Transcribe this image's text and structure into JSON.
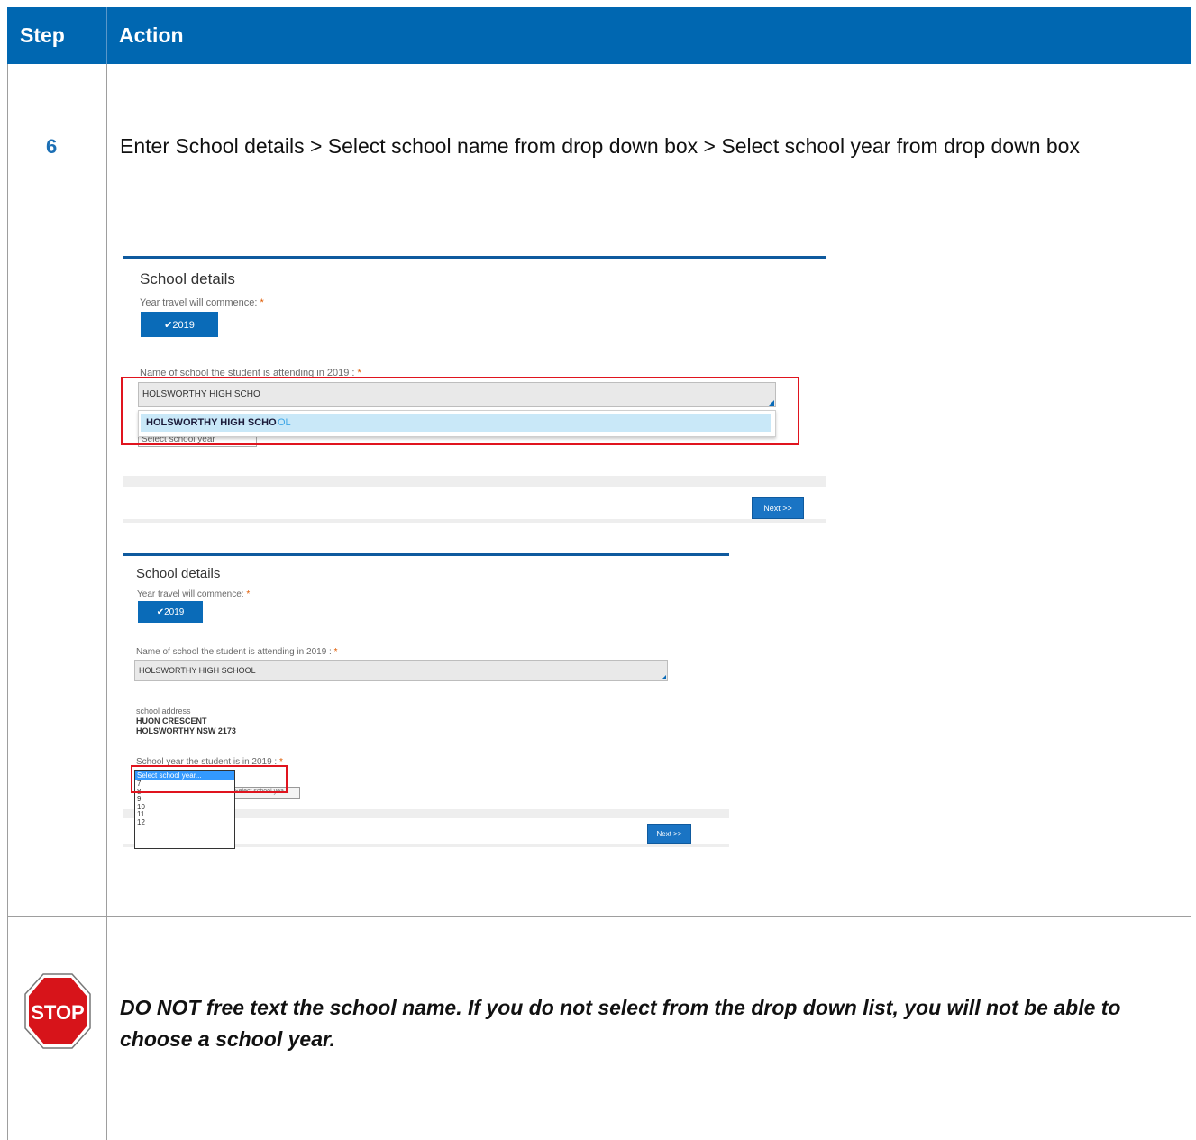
{
  "header": {
    "step": "Step",
    "action": "Action"
  },
  "step": {
    "number": "6",
    "instruction": "Enter School details > Select school name from drop down box > Select school year from drop down box"
  },
  "shot1": {
    "title": "School details",
    "year_label": "Year travel will commence:",
    "year_button": "✔2019",
    "school_label": "Name of school the student is attending in 2019 :",
    "school_input": "HOLSWORTHY HIGH SCHO",
    "suggestion_match": "HOLSWORTHY HIGH SCHO",
    "suggestion_rest": "OL",
    "hidden_select": "Select school year",
    "next": "Next >>"
  },
  "shot2": {
    "title": "School details",
    "year_label": "Year travel will commence:",
    "year_button": "✔2019",
    "school_label": "Name of school the student is attending in 2019 :",
    "school_input": "HOLSWORTHY HIGH SCHOOL",
    "address_label": "school address",
    "address_line1": "HUON CRESCENT",
    "address_line2": "HOLSWORTHY NSW 2173",
    "year_select_label": "School year the student is in 2019 :",
    "select_options": [
      "Select school year...",
      "7",
      "8",
      "9",
      "10",
      "11",
      "12"
    ],
    "tooltip": "Select school yea...",
    "next": "Next >>"
  },
  "warning": {
    "icon_text": "STOP",
    "text": "DO NOT free text the school name.  If you do not select from the drop down list, you will not be able to choose a school year."
  },
  "colors": {
    "header": "#0067b1",
    "step_number": "#1b6fb5",
    "highlight": "#e0141e",
    "stop": "#d7141a"
  }
}
